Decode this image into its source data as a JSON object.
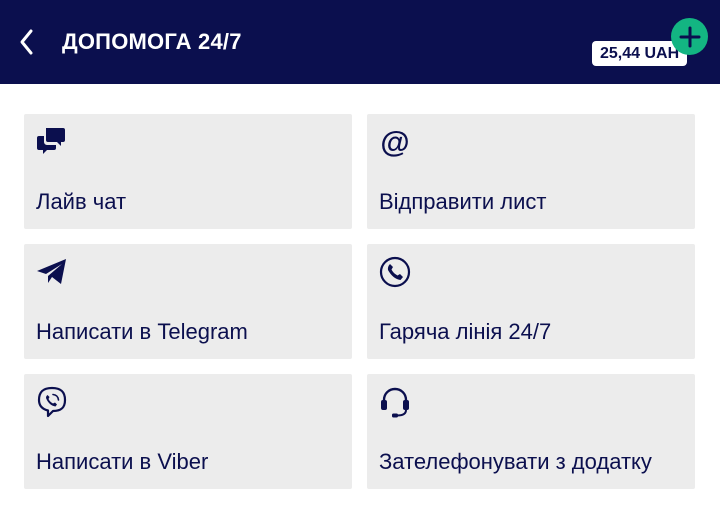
{
  "header": {
    "title": "ДОПОМОГА 24/7",
    "balance": "25,44 UAH",
    "back_icon": "chevron-left-icon",
    "add_icon": "plus-icon"
  },
  "colors": {
    "header_bg": "#0b0f4e",
    "card_bg": "#ececec",
    "accent_green": "#13b582",
    "text": "#0b0f4e"
  },
  "options": [
    {
      "label": "Лайв чат",
      "icon": "chat-bubbles-icon"
    },
    {
      "label": "Відправити лист",
      "icon": "at-sign-icon"
    },
    {
      "label": "Написати в Telegram",
      "icon": "telegram-icon"
    },
    {
      "label": "Гаряча лінія 24/7",
      "icon": "phone-icon"
    },
    {
      "label": "Написати в Viber",
      "icon": "viber-icon"
    },
    {
      "label": "Зателефонувати з додатку",
      "icon": "headset-icon"
    }
  ]
}
